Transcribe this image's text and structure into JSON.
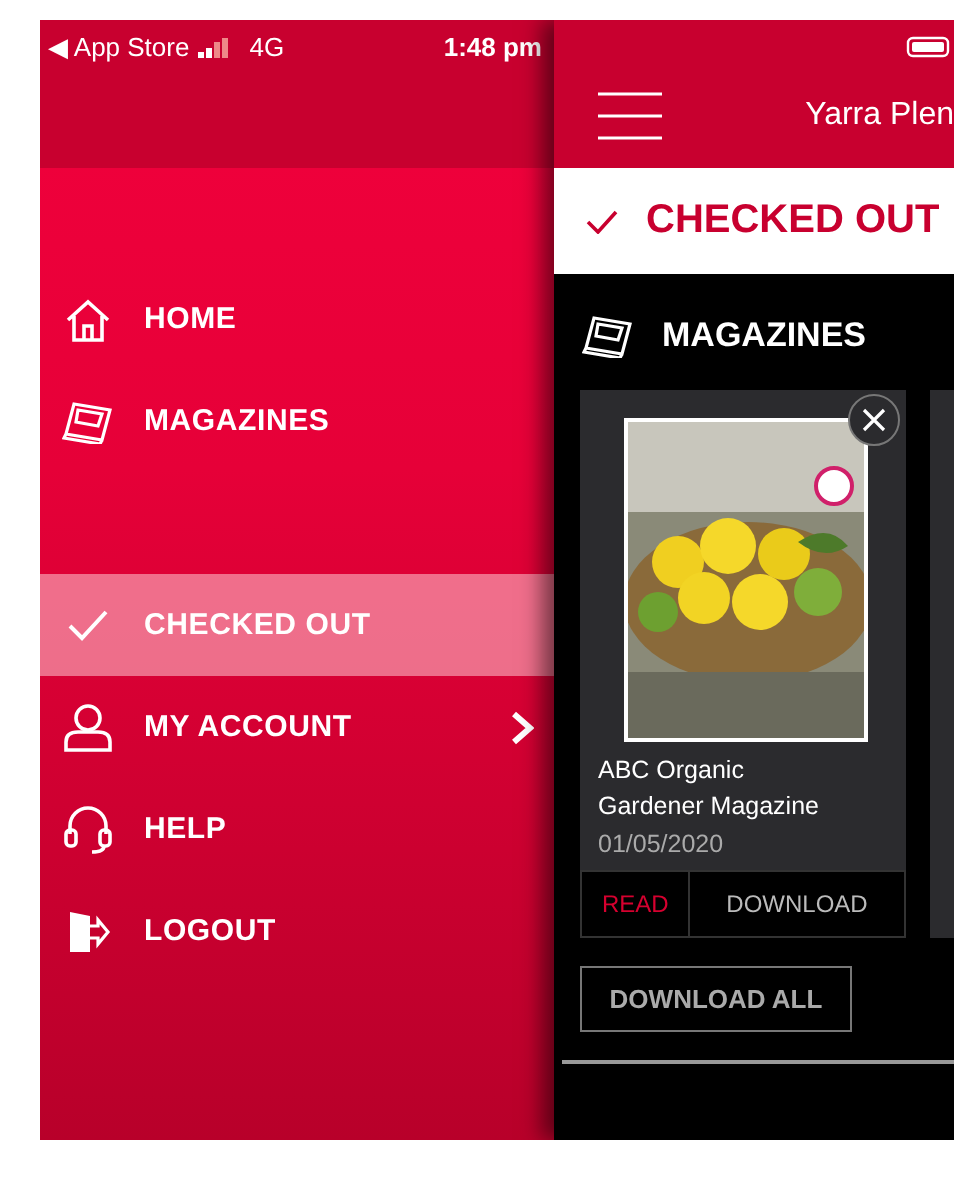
{
  "status_bar": {
    "back_label": "◀ App Store",
    "network": "4G",
    "time": "1:48 pm"
  },
  "drawer": {
    "items": [
      {
        "kind": "home",
        "label": "HOME",
        "selected": false,
        "has_submenu": false
      },
      {
        "kind": "magazines",
        "label": "MAGAZINES",
        "selected": false,
        "has_submenu": false
      },
      {
        "kind": "checked",
        "label": "CHECKED OUT",
        "selected": true,
        "has_submenu": false
      },
      {
        "kind": "account",
        "label": "MY ACCOUNT",
        "selected": false,
        "has_submenu": true
      },
      {
        "kind": "help",
        "label": "HELP",
        "selected": false,
        "has_submenu": false
      },
      {
        "kind": "logout",
        "label": "LOGOUT",
        "selected": false,
        "has_submenu": false
      }
    ]
  },
  "header": {
    "title": "Yarra Plen"
  },
  "page_title": "CHECKED OUT",
  "section": {
    "title": "MAGAZINES",
    "items": [
      {
        "kind": "picture",
        "title": "ABC Organic Gardener Magazine",
        "date": "01/05/2020",
        "actions": [
          {
            "label": "READ",
            "primary": true
          },
          {
            "label": "DOWNLOAD",
            "primary": false
          }
        ]
      }
    ]
  },
  "download_all": "DOWNLOAD ALL"
}
